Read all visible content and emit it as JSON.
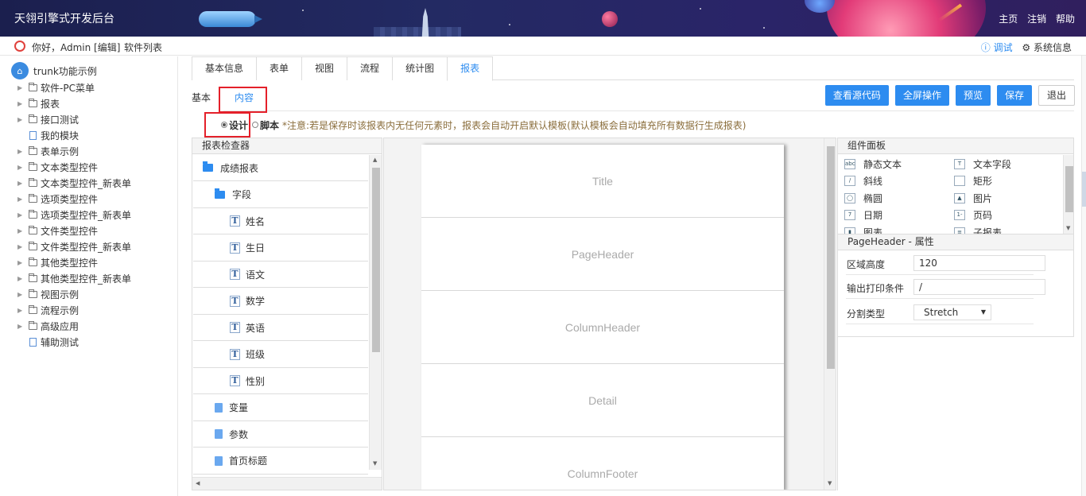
{
  "header": {
    "app_title": "天翎引擎式开发后台",
    "nav": [
      "主页",
      "注销",
      "帮助"
    ]
  },
  "userbar": {
    "greeting": "你好，Admin [编辑]",
    "software_list": "软件列表",
    "debug": "ⓘ 调试",
    "system_info": "⚙ 系统信息"
  },
  "tree": {
    "root": "trunk功能示例",
    "items": [
      {
        "label": "软件-PC菜单",
        "type": "folder"
      },
      {
        "label": "报表",
        "type": "folder"
      },
      {
        "label": "接口测试",
        "type": "folder"
      },
      {
        "label": "我的模块",
        "type": "file"
      },
      {
        "label": "表单示例",
        "type": "folder"
      },
      {
        "label": "文本类型控件",
        "type": "folder"
      },
      {
        "label": "文本类型控件_新表单",
        "type": "folder"
      },
      {
        "label": "选项类型控件",
        "type": "folder"
      },
      {
        "label": "选项类型控件_新表单",
        "type": "folder"
      },
      {
        "label": "文件类型控件",
        "type": "folder"
      },
      {
        "label": "文件类型控件_新表单",
        "type": "folder"
      },
      {
        "label": "其他类型控件",
        "type": "folder"
      },
      {
        "label": "其他类型控件_新表单",
        "type": "folder"
      },
      {
        "label": "视图示例",
        "type": "folder"
      },
      {
        "label": "流程示例",
        "type": "folder"
      },
      {
        "label": "高级应用",
        "type": "folder"
      },
      {
        "label": "辅助测试",
        "type": "file"
      }
    ]
  },
  "tabs": [
    "基本信息",
    "表单",
    "视图",
    "流程",
    "统计图",
    "报表"
  ],
  "active_tab": "报表",
  "subtabs": {
    "basic": "基本",
    "content": "内容"
  },
  "actions": {
    "view_source": "查看源代码",
    "fullscreen": "全屏操作",
    "preview": "预览",
    "save": "保存",
    "exit": "退出"
  },
  "mode": {
    "design": "设计",
    "script": "脚本",
    "note": "*注意:若是保存时该报表内无任何元素时，报表会自动开启默认模板(默认模板会自动填充所有数据行生成报表)"
  },
  "inspector": {
    "title": "报表检查器",
    "rows": [
      {
        "label": "成绩报表",
        "icon": "folder",
        "indent": 0
      },
      {
        "label": "字段",
        "icon": "folder",
        "indent": 1
      },
      {
        "label": "姓名",
        "icon": "text",
        "indent": 2
      },
      {
        "label": "生日",
        "icon": "text",
        "indent": 2
      },
      {
        "label": "语文",
        "icon": "text",
        "indent": 2
      },
      {
        "label": "数学",
        "icon": "text",
        "indent": 2
      },
      {
        "label": "英语",
        "icon": "text",
        "indent": 2
      },
      {
        "label": "班级",
        "icon": "text",
        "indent": 2
      },
      {
        "label": "性别",
        "icon": "text",
        "indent": 2
      },
      {
        "label": "变量",
        "icon": "doc",
        "indent": 1
      },
      {
        "label": "参数",
        "icon": "doc",
        "indent": 1
      },
      {
        "label": "首页标题",
        "icon": "doc",
        "indent": 1
      }
    ]
  },
  "canvas": {
    "bands": [
      "Title",
      "PageHeader",
      "ColumnHeader",
      "Detail",
      "ColumnFooter"
    ]
  },
  "components": {
    "title": "组件面板",
    "items": [
      {
        "label": "静态文本",
        "icon": "abc-icon"
      },
      {
        "label": "文本字段",
        "icon": "T-icon"
      },
      {
        "label": "斜线",
        "icon": "line-icon"
      },
      {
        "label": "矩形",
        "icon": "rect-icon"
      },
      {
        "label": "椭圆",
        "icon": "ellipse-icon"
      },
      {
        "label": "图片",
        "icon": "image-icon"
      },
      {
        "label": "日期",
        "icon": "calendar-icon"
      },
      {
        "label": "页码",
        "icon": "pagenum-icon"
      },
      {
        "label": "图表",
        "icon": "chart-icon"
      },
      {
        "label": "子报表",
        "icon": "subreport-icon"
      }
    ]
  },
  "properties": {
    "title": "PageHeader - 属性",
    "region_height_label": "区域高度",
    "region_height_value": "120",
    "print_cond_label": "输出打印条件",
    "print_cond_value": "/",
    "split_type_label": "分割类型",
    "split_type_value": "Stretch"
  }
}
